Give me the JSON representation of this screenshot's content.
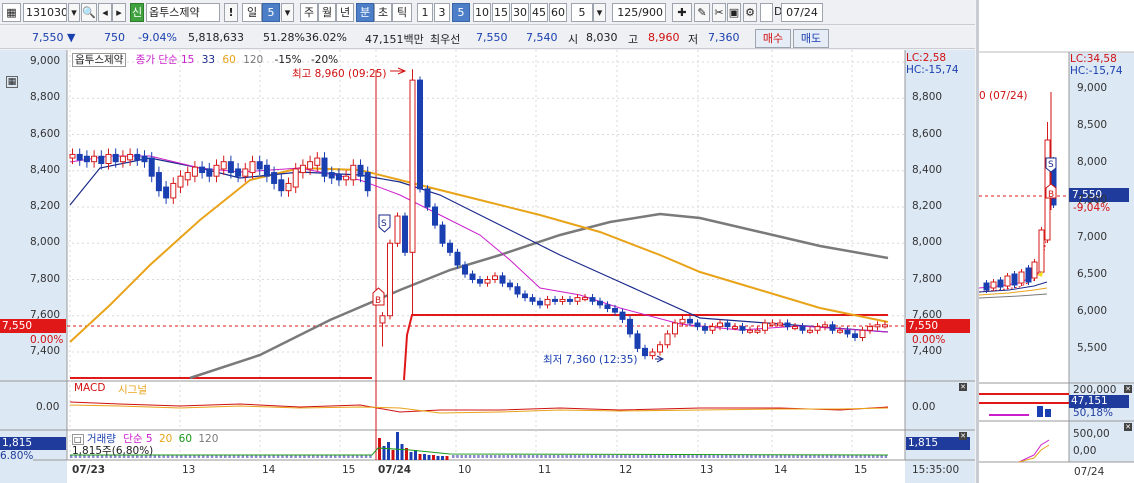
{
  "toolbar": {
    "code": "131030",
    "stock_name": "옵투스제약",
    "credit_badge": "신",
    "alert_label": "!",
    "period_day": "일",
    "period_num": "5",
    "periods": [
      "주",
      "월",
      "년",
      "분",
      "초",
      "틱"
    ],
    "intervals": [
      "1",
      "3",
      "5",
      "10",
      "15",
      "30",
      "45",
      "60"
    ],
    "count_value": "5",
    "count_display": "125/900",
    "date_value": "07/24",
    "checkbox_label": "D"
  },
  "quote": {
    "price": "7,550",
    "arrow": "▼",
    "change": "750",
    "change_pct": "-9.04%",
    "volume": "5,818,633",
    "ratio1": "51.28%",
    "ratio2": "36.02%",
    "amount": "47,151백만",
    "best_label": "최우선",
    "best_ask": "7,550",
    "best_bid": "7,540",
    "open_label": "시",
    "open": "8,030",
    "high_label": "고",
    "high": "8,960",
    "low_label": "저",
    "low": "7,360",
    "buy_label": "매수",
    "sell_label": "매도"
  },
  "legend": {
    "stock": "옵투스제약",
    "ma_label": "종가 단순",
    "ma15": "15",
    "ma33": "33",
    "ma60": "60",
    "ma120": "120",
    "pct1": "-15%",
    "pct2": "-20%",
    "colors": {
      "ma15": "#cc1fcc",
      "ma33": "#1a2a8c",
      "ma60": "#e8a319",
      "ma120": "#7a7a7a",
      "up": "#d51a1a",
      "down": "#1a3fb0"
    }
  },
  "annotations": {
    "high": "최고 8,960 (09:25)",
    "low": "최저 7,360 (12:35)",
    "buy_marker": "B",
    "sell_marker": "S"
  },
  "price_axis": {
    "left": [
      "9,000",
      "8,800",
      "8,600",
      "8,400",
      "8,200",
      "8,000",
      "7,800",
      "7,600",
      "7,400"
    ],
    "right": [
      "8,800",
      "8,600",
      "8,400",
      "8,200",
      "8,000",
      "7,800",
      "7,600",
      "7,400"
    ],
    "current_left": "7,550",
    "current_left_pct": "0.00%",
    "current_right": "7,550",
    "current_right_pct": "0.00%",
    "lc": "LC:2,58",
    "hc": "HC:-15,74"
  },
  "macd": {
    "label": "MACD",
    "signal": "시그널",
    "left_zero": "0.00",
    "right_zero": "0.00"
  },
  "volume": {
    "label": "거래량",
    "ma_label": "단순",
    "ma5": "5",
    "ma20": "20",
    "ma60": "60",
    "ma120": "120",
    "value": "1,815주(6,80%)",
    "box_left": "1,815",
    "box_right": "1,815",
    "pct_left": "6.80%"
  },
  "time_axis": {
    "labels": [
      "07/23",
      "13",
      "14",
      "15",
      "07/24",
      "10",
      "11",
      "12",
      "13",
      "14",
      "15"
    ],
    "clock": "15:35:00"
  },
  "side": {
    "high_note": "0 (07/24)",
    "lc": "LC:34,58",
    "hc": "HC:-15,74",
    "axis": [
      "9,000",
      "8,500",
      "8,000",
      "7,500",
      "7,000",
      "6,500",
      "6,000",
      "5,500"
    ],
    "price": "7,550",
    "pct": "-9,04%",
    "vol_axis": "200,000",
    "vol_box": "47,151",
    "vol_pct": "50,18%",
    "amt_axis": "500,00",
    "amt_zero": "0,00",
    "date": "07/24"
  }
}
